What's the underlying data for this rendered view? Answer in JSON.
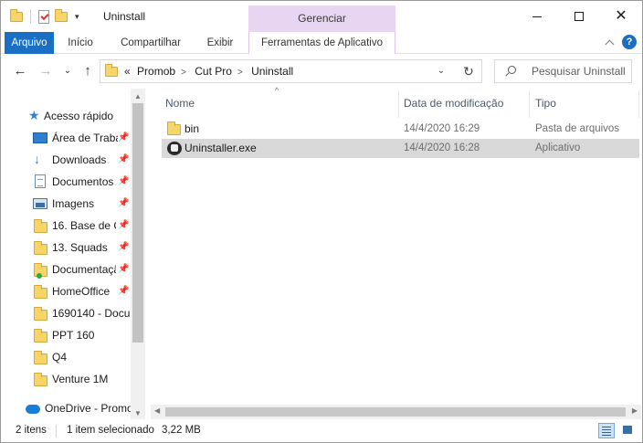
{
  "window": {
    "title": "Uninstall",
    "qat_dropdown": "▾",
    "controls": {
      "close": "✕"
    }
  },
  "ribbon": {
    "context_group": "Gerenciar",
    "tabs": [
      {
        "label": "Arquivo",
        "active": true
      },
      {
        "label": "Início"
      },
      {
        "label": "Compartilhar"
      },
      {
        "label": "Exibir"
      },
      {
        "label": "Ferramentas de Aplicativo"
      }
    ],
    "help": "?"
  },
  "nav": {
    "back": "←",
    "forward": "→",
    "recent": "⌄",
    "up": "↑",
    "overflow": "«",
    "breadcrumbs": [
      "Promob",
      "Cut Pro",
      "Uninstall"
    ],
    "separator": ">",
    "dropdown": "⌄",
    "refresh": "↻",
    "search_placeholder": "Pesquisar Uninstall"
  },
  "sidebar": {
    "items": [
      {
        "label": "Acesso rápido",
        "icon": "star-icon"
      },
      {
        "label": "Área de Traba",
        "icon": "desktop-icon",
        "pinned": true
      },
      {
        "label": "Downloads",
        "icon": "download-icon",
        "pinned": true
      },
      {
        "label": "Documentos",
        "icon": "document-icon",
        "pinned": true
      },
      {
        "label": "Imagens",
        "icon": "pictures-icon",
        "pinned": true
      },
      {
        "label": "16. Base de C",
        "icon": "folder-icon",
        "pinned": true
      },
      {
        "label": "13. Squads",
        "icon": "folder-icon",
        "pinned": true
      },
      {
        "label": "Documentaçã",
        "icon": "synced-folder-icon",
        "pinned": true
      },
      {
        "label": "HomeOffice",
        "icon": "folder-icon",
        "pinned": true
      },
      {
        "label": "1690140 - Docur",
        "icon": "folder-icon"
      },
      {
        "label": "PPT 160",
        "icon": "folder-icon"
      },
      {
        "label": "Q4",
        "icon": "folder-icon"
      },
      {
        "label": "Venture 1M",
        "icon": "folder-icon"
      },
      {
        "label": "OneDrive - Promo",
        "icon": "cloud-icon"
      }
    ],
    "pin_glyph": "📌"
  },
  "columns": {
    "name": "Nome",
    "modified": "Data de modificação",
    "type": "Tipo",
    "sort_indicator": "^"
  },
  "files": [
    {
      "name": "bin",
      "modified": "14/4/2020 16:29",
      "type": "Pasta de arquivos",
      "icon": "folder-icon",
      "selected": false
    },
    {
      "name": "Uninstaller.exe",
      "modified": "14/4/2020 16:28",
      "type": "Aplicativo",
      "icon": "uninstaller-app-icon",
      "selected": true
    }
  ],
  "status": {
    "count": "2 itens",
    "selection": "1 item selecionado",
    "size": "3,22 MB"
  },
  "colors": {
    "accent": "#1a6fc4",
    "manage_tab": "#e8d5f2",
    "selection": "#d9d9d9"
  }
}
